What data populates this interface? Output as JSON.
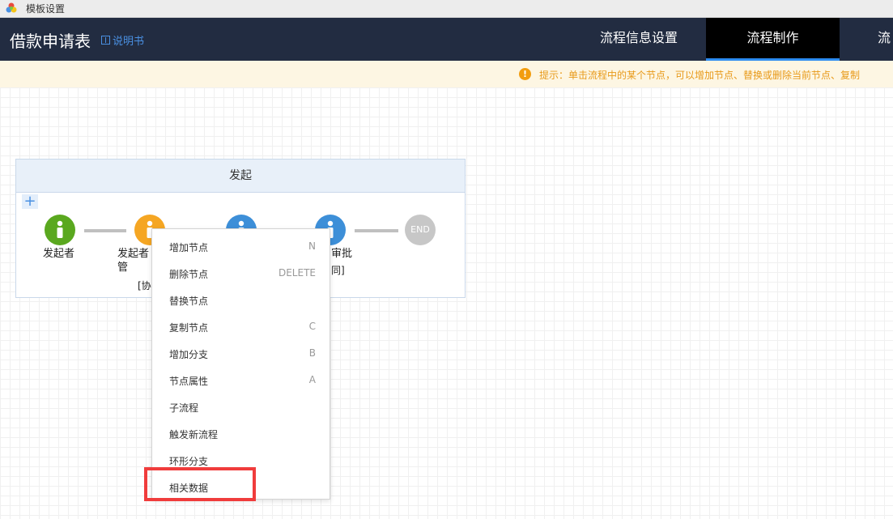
{
  "window": {
    "title": "模板设置",
    "logo_icon": "app-logo-icon"
  },
  "header": {
    "form_title": "借款申请表",
    "manual_link": "说明书",
    "tabs": [
      {
        "label": "流程信息设置",
        "active": false
      },
      {
        "label": "流程制作",
        "active": true
      },
      {
        "label": "流",
        "active": false
      }
    ],
    "active_tab_color": "#2d8cf0"
  },
  "hint": {
    "icon": "!",
    "text": "提示：单击流程中的某个节点，可以增加节点、替换或删除当前节点、复制"
  },
  "lane": {
    "title": "发起",
    "add_symbol": "+"
  },
  "nodes": [
    {
      "type": "person",
      "color": "#5aa81f",
      "label_line1": "发起者",
      "label_line2": "",
      "label_line3": ""
    },
    {
      "type": "person",
      "color": "#f5a623",
      "label_line1": "发起者",
      "label_line2": "管",
      "label_line3": "[协"
    },
    {
      "type": "person",
      "color": "#3d8fd8",
      "label_line1": "",
      "label_line2": "",
      "label_line3": ""
    },
    {
      "type": "person",
      "color": "#3d8fd8",
      "label_line1": "审批",
      "label_line2": "同]",
      "label_line3": ""
    },
    {
      "type": "end",
      "color": "#c7c7c7",
      "label": "END"
    }
  ],
  "context_menu": {
    "items": [
      {
        "label": "增加节点",
        "shortcut": "N"
      },
      {
        "label": "删除节点",
        "shortcut": "DELETE"
      },
      {
        "label": "替换节点",
        "shortcut": ""
      },
      {
        "label": "复制节点",
        "shortcut": "C"
      },
      {
        "label": "增加分支",
        "shortcut": "B"
      },
      {
        "label": "节点属性",
        "shortcut": "A"
      },
      {
        "label": "子流程",
        "shortcut": ""
      },
      {
        "label": "触发新流程",
        "shortcut": ""
      },
      {
        "label": "环形分支",
        "shortcut": ""
      },
      {
        "label": "相关数据",
        "shortcut": "",
        "highlighted": true
      }
    ],
    "highlight_color": "#f03c3c"
  }
}
